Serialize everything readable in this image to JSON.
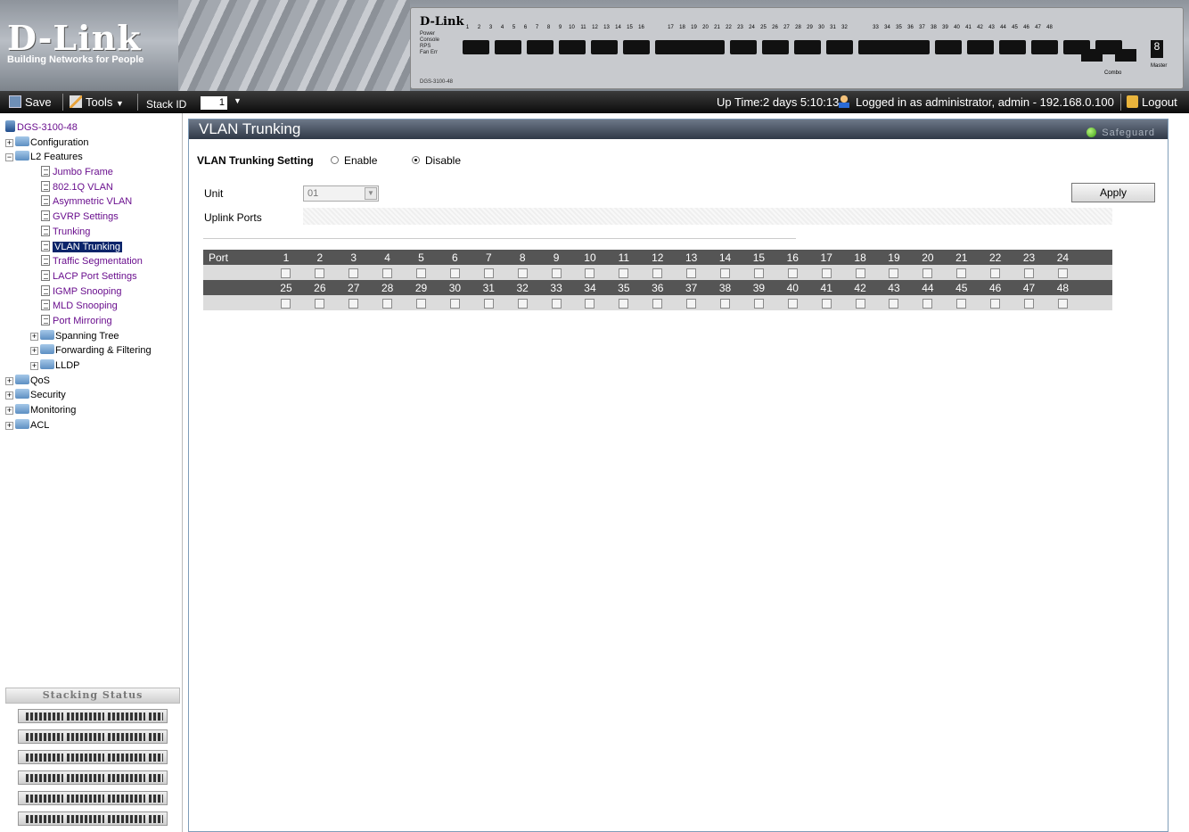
{
  "header": {
    "logo_name": "D-Link",
    "logo_tagline": "Building Networks for People",
    "panel_brand": "D-Link",
    "panel_model": "DGS-3100-48",
    "panel_leds": [
      "Power",
      "Console",
      "RPS",
      "Fan Err"
    ],
    "panel_port_numbers_row1": [
      "1",
      "2",
      "3",
      "4",
      "5",
      "6",
      "7",
      "8",
      "9",
      "10",
      "11",
      "12",
      "13",
      "14",
      "15",
      "16"
    ],
    "panel_port_numbers_row2": [
      "17",
      "18",
      "19",
      "20",
      "21",
      "22",
      "23",
      "24",
      "25",
      "26",
      "27",
      "28",
      "29",
      "30",
      "31",
      "32"
    ],
    "panel_port_numbers_row3": [
      "33",
      "34",
      "35",
      "36",
      "37",
      "38",
      "39",
      "40",
      "41",
      "42",
      "43",
      "44",
      "45",
      "46",
      "47",
      "48"
    ],
    "combo_label": "Combo",
    "master_label": "Master",
    "unit_digit": "8"
  },
  "toolbar": {
    "save_label": "Save",
    "tools_label": "Tools",
    "stack_id_label": "Stack ID",
    "stack_id_value": "1",
    "uptime": "Up Time:2 days 5:10:13",
    "login_info": "Logged in as administrator, admin - 192.168.0.100",
    "logout_label": "Logout"
  },
  "tree": {
    "root": "DGS-3100-48",
    "configuration": "Configuration",
    "l2": "L2 Features",
    "l2_items": [
      "Jumbo Frame",
      "802.1Q VLAN",
      "Asymmetric VLAN",
      "GVRP Settings",
      "Trunking",
      "VLAN Trunking",
      "Traffic Segmentation",
      "LACP Port Settings",
      "IGMP Snooping",
      "MLD Snooping",
      "Port Mirroring"
    ],
    "l2_folders": [
      "Spanning Tree",
      "Forwarding & Filtering",
      "LLDP"
    ],
    "qos": "QoS",
    "security": "Security",
    "monitoring": "Monitoring",
    "acl": "ACL"
  },
  "stacking": {
    "title": "Stacking Status",
    "units": 6
  },
  "main": {
    "title": "VLAN Trunking",
    "safeguard": "Safeguard",
    "setting_label": "VLAN Trunking Setting",
    "enable_label": "Enable",
    "disable_label": "Disable",
    "selected": "Disable",
    "unit_label": "Unit",
    "unit_value": "01",
    "uplink_label": "Uplink Ports",
    "apply_label": "Apply",
    "port_label": "Port",
    "ports_row1": [
      "1",
      "2",
      "3",
      "4",
      "5",
      "6",
      "7",
      "8",
      "9",
      "10",
      "11",
      "12",
      "13",
      "14",
      "15",
      "16",
      "17",
      "18",
      "19",
      "20",
      "21",
      "22",
      "23",
      "24"
    ],
    "ports_row2": [
      "25",
      "26",
      "27",
      "28",
      "29",
      "30",
      "31",
      "32",
      "33",
      "34",
      "35",
      "36",
      "37",
      "38",
      "39",
      "40",
      "41",
      "42",
      "43",
      "44",
      "45",
      "46",
      "47",
      "48"
    ]
  },
  "colors": {
    "title_bar": "#4a5563",
    "link": "#6a0f8e",
    "selected_bg": "#0a246a",
    "port_header_bg": "#555555",
    "port_row_bg": "#dcdcdc"
  }
}
